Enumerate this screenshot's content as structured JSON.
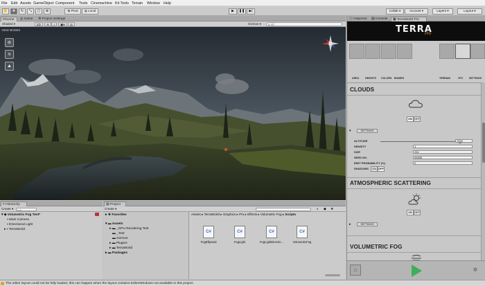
{
  "menu": [
    "File",
    "Edit",
    "Assets",
    "GameObject",
    "Component",
    "Tools",
    "Cinemachine",
    "Kit Tools",
    "Terrain",
    "Window",
    "Help"
  ],
  "toolbar": {
    "pivot": "Pivot",
    "local": "Local",
    "collab": "Collab",
    "account": "Account",
    "layers": "Layers",
    "layout": "Layout"
  },
  "scene": {
    "tabs": [
      "Scene",
      "Game",
      "Project Settings"
    ],
    "shading": "Shaded",
    "dim": "2D",
    "gizmos": "Gizmos",
    "search_placeholder": "All",
    "view_modes": "VIEW MODES"
  },
  "hierarchy": {
    "tab": "Hierarchy",
    "create": "Create",
    "search_placeholder": "All",
    "scene_name": "Volumetric Fog Test*",
    "items": [
      "Main Camera",
      "Directional Light",
      "TerraWorld"
    ]
  },
  "project": {
    "tab": "Project",
    "create": "Create",
    "favorites": "Favorites",
    "assets": "Assets",
    "folders": [
      "_GPU Rendering Test",
      "_Test",
      "Gizmos",
      "Plugins",
      "TerraWorld"
    ],
    "packages": "Packages",
    "breadcrumb": [
      "Assets",
      "TerraWorld",
      "Graphics",
      "Pro",
      "Effects",
      "Volumetric Fog",
      "Scripts"
    ],
    "files": [
      "FogEllipsoid",
      "FogLight",
      "FogLightDirectio...",
      "VolumetricFog"
    ],
    "file_icon_text": "C#"
  },
  "inspector": {
    "tabs": [
      "Inspector",
      "Console",
      "TerraWorld Pro"
    ],
    "logo": "TERRA",
    "logo_sub": "Pro",
    "left_cats": [
      "AREA",
      "HEIGHTS",
      "COLORS",
      "BIOMES"
    ],
    "right_cats": [
      "TERRAIN",
      "VFX",
      "SETTINGS"
    ],
    "sections": {
      "clouds": "CLOUDS",
      "atmo": "ATMOSPHERIC SCATTERING",
      "fog": "VOLUMETRIC FOG"
    },
    "on": "ON",
    "off": "OFF",
    "settings": "SETTINGS",
    "params": [
      {
        "label": "ALTITUDE",
        "value": "7000"
      },
      {
        "label": "DENSITY",
        "value": "1"
      },
      {
        "label": "SIZE",
        "value": "250"
      },
      {
        "label": "SEED NO.",
        "value": "55555"
      },
      {
        "label": "EMIT PROBABILITY (%)",
        "value": "0"
      }
    ],
    "shadows_label": "SHADOWS",
    "altitude_slider": 0.93
  },
  "status": "The editor layout could not be fully loaded, this can happen when the layout contains EditorWindows not available in this project",
  "colors": {
    "play": "#3fae5a",
    "banner": "#0d0d0d",
    "scene_sky": "#56616b"
  }
}
